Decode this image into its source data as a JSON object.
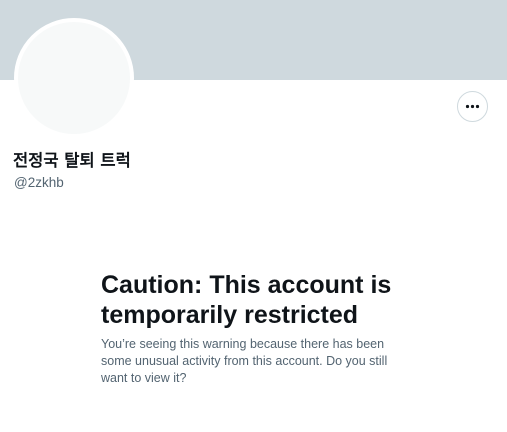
{
  "profile": {
    "display_name": "전정국 탈퇴 트럭",
    "handle": "@2zkhb"
  },
  "actions": {
    "more_icon": "ellipsis-horizontal-icon"
  },
  "warning": {
    "title": "Caution: This account is temporarily restricted",
    "body": "You’re seeing this warning because there has been some unusual activity from this account. Do you still want to view it?"
  },
  "colors": {
    "banner": "#cfd9de",
    "avatar_fill": "#f7f9f9",
    "primary_text": "#0f1419",
    "secondary_text": "#536471",
    "border": "#cfd9de"
  }
}
